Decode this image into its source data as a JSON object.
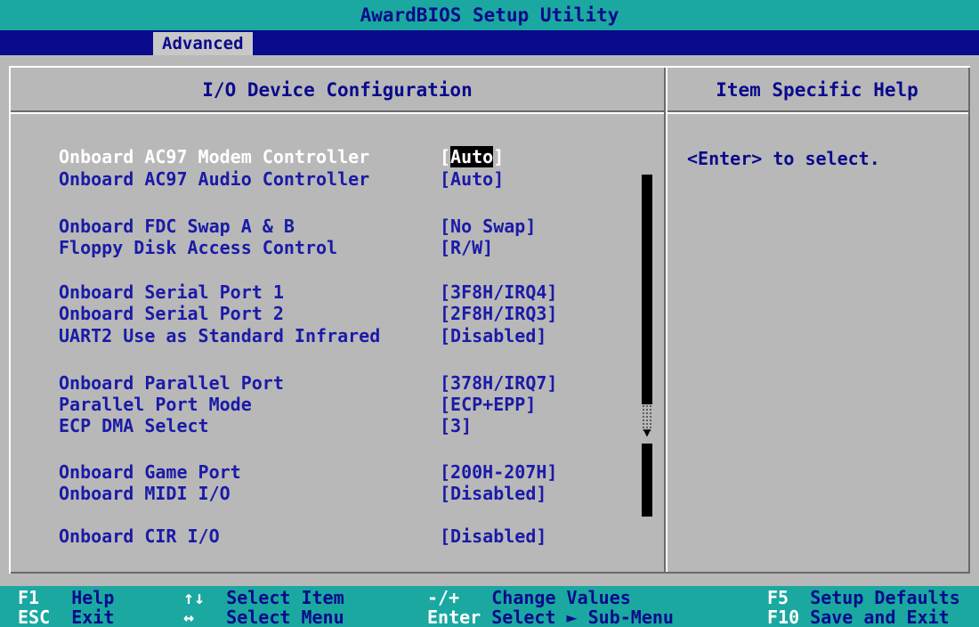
{
  "app_title": "AwardBIOS Setup Utility",
  "menu_tab": "Advanced",
  "panel_title": "I/O Device Configuration",
  "help_title": "Item Specific Help",
  "help_text": "<Enter> to select.",
  "settings": [
    {
      "label": "Onboard AC97 Modem Controller",
      "value_prefix": "[",
      "value_main": "Auto",
      "value_suffix": "]"
    },
    {
      "label": "Onboard AC97 Audio Controller",
      "value": "[Auto]"
    },
    {
      "label": "Onboard FDC Swap A & B",
      "value": "[No Swap]"
    },
    {
      "label": "Floppy Disk Access Control",
      "value": "[R/W]"
    },
    {
      "label": "Onboard Serial Port 1",
      "value": "[3F8H/IRQ4]"
    },
    {
      "label": "Onboard Serial Port 2",
      "value": "[2F8H/IRQ3]"
    },
    {
      "label": "UART2 Use as Standard Infrared",
      "value": "[Disabled]"
    },
    {
      "label": "Onboard Parallel Port",
      "value": "[378H/IRQ7]"
    },
    {
      "label": "Parallel Port Mode",
      "value": "[ECP+EPP]"
    },
    {
      "label": "ECP DMA Select",
      "value": "[3]"
    },
    {
      "label": "Onboard Game Port",
      "value": "[200H-207H]"
    },
    {
      "label": "Onboard MIDI I/O",
      "value": "[Disabled]"
    },
    {
      "label": "Onboard CIR I/O",
      "value": "[Disabled]"
    }
  ],
  "footer": {
    "row1": [
      {
        "key": "F1",
        "desc": "Help"
      },
      {
        "key": "↑↓",
        "desc": "Select Item"
      },
      {
        "key": "-/+",
        "desc": "Change Values"
      },
      {
        "key": "F5",
        "desc": "Setup Defaults"
      }
    ],
    "row2": [
      {
        "key": "ESC",
        "desc": "Exit"
      },
      {
        "key": "↔",
        "desc": "Select Menu"
      },
      {
        "key": "Enter",
        "desc": "Select ► Sub-Menu"
      },
      {
        "key": "F10",
        "desc": "Save and Exit"
      }
    ]
  },
  "colors": {
    "title_bar": "#1aa8a0",
    "menu_bar": "#0a0a8c",
    "panel": "#b8b8b8",
    "text": "#1a1aa8",
    "selected_text": "#ffffff"
  }
}
